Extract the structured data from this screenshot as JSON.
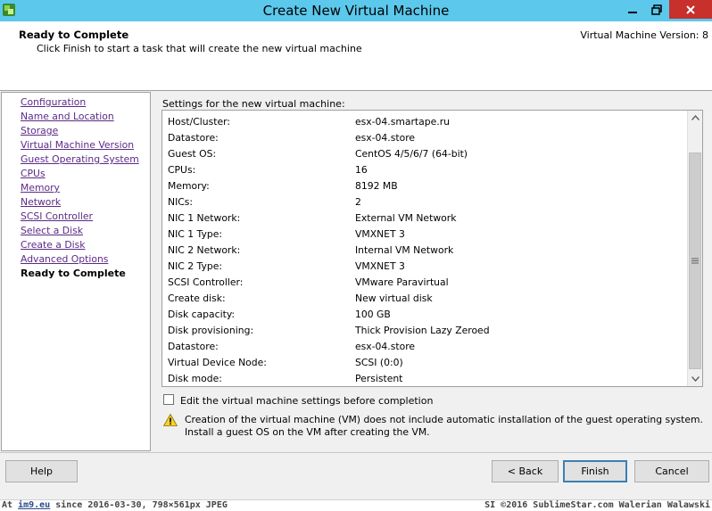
{
  "window": {
    "title": "Create New Virtual Machine",
    "icons": {
      "app": "vsphere-app-icon",
      "minimize": "minimize-icon",
      "maximize": "restore-icon",
      "close": "close-icon"
    },
    "close_color": "#c7302b",
    "titlebar_color": "#5bc8ec"
  },
  "header": {
    "title": "Ready to Complete",
    "description": "Click Finish to start a task that will create the new virtual machine",
    "version": "Virtual Machine Version: 8"
  },
  "nav": {
    "items": [
      {
        "label": "Configuration"
      },
      {
        "label": "Name and Location"
      },
      {
        "label": "Storage"
      },
      {
        "label": "Virtual Machine Version"
      },
      {
        "label": "Guest Operating System"
      },
      {
        "label": "CPUs"
      },
      {
        "label": "Memory"
      },
      {
        "label": "Network"
      },
      {
        "label": "SCSI Controller"
      },
      {
        "label": "Select a Disk"
      },
      {
        "label": "Create a Disk"
      },
      {
        "label": "Advanced Options"
      },
      {
        "label": "Ready to Complete",
        "current": true
      }
    ]
  },
  "settings": {
    "label": "Settings for the new virtual machine:",
    "rows": [
      {
        "key": "Host/Cluster:",
        "value": "esx-04.smartape.ru"
      },
      {
        "key": "Datastore:",
        "value": "esx-04.store"
      },
      {
        "key": "Guest OS:",
        "value": "CentOS 4/5/6/7 (64-bit)"
      },
      {
        "key": "CPUs:",
        "value": "16"
      },
      {
        "key": "Memory:",
        "value": "8192 MB"
      },
      {
        "key": "NICs:",
        "value": "2"
      },
      {
        "key": "NIC 1 Network:",
        "value": "External VM Network"
      },
      {
        "key": "NIC 1 Type:",
        "value": "VMXNET 3"
      },
      {
        "key": "NIC 2 Network:",
        "value": "Internal VM Network"
      },
      {
        "key": "NIC 2 Type:",
        "value": "VMXNET 3"
      },
      {
        "key": "SCSI Controller:",
        "value": "VMware Paravirtual"
      },
      {
        "key": "Create disk:",
        "value": "New virtual disk"
      },
      {
        "key": "Disk capacity:",
        "value": "100 GB"
      },
      {
        "key": "Disk provisioning:",
        "value": "Thick Provision Lazy Zeroed"
      },
      {
        "key": "Datastore:",
        "value": "esx-04.store"
      },
      {
        "key": "Virtual Device Node:",
        "value": "SCSI (0:0)"
      },
      {
        "key": "Disk mode:",
        "value": "Persistent"
      }
    ],
    "scroll_icons": {
      "up": "scroll-up-arrow-icon",
      "down": "scroll-down-arrow-icon",
      "grip": "scroll-grip-icon"
    }
  },
  "options": {
    "edit_before_completion": {
      "label": "Edit the virtual machine settings before completion",
      "checked": false
    }
  },
  "warning": {
    "icon": "warning-triangle-icon",
    "text": "Creation of the virtual machine (VM) does not include automatic installation of the guest operating system. Install a guest OS on the VM after creating the VM."
  },
  "buttons": {
    "help": "Help",
    "back": "< Back",
    "finish": "Finish",
    "cancel": "Cancel"
  },
  "statusbar": {
    "prefix": "At ",
    "link": "im9.eu",
    "left_rest": " since 2016-03-30, 798×561px JPEG",
    "right": "SI ©2016 SublimeStar.com Walerian Walawski"
  }
}
